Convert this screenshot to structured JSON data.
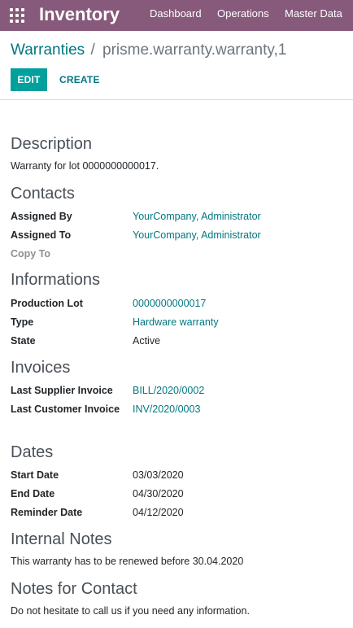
{
  "navbar": {
    "app_title": "Inventory",
    "menu": [
      "Dashboard",
      "Operations",
      "Master Data"
    ],
    "background": "#875a7b"
  },
  "breadcrumb": {
    "parent": "Warranties",
    "separator": "/",
    "current": "prisme.warranty.warranty,1"
  },
  "buttons": {
    "edit": "EDIT",
    "create": "CREATE"
  },
  "form": {
    "description": {
      "title": "Description",
      "text": "Warranty for lot 0000000000017."
    },
    "contacts": {
      "title": "Contacts",
      "fields": [
        {
          "label": "Assigned By",
          "value": "YourCompany, Administrator"
        },
        {
          "label": "Assigned To",
          "value": "YourCompany, Administrator"
        },
        {
          "label": "Copy To",
          "value": ""
        }
      ]
    },
    "informations": {
      "title": "Informations",
      "fields": [
        {
          "label": "Production Lot",
          "value": "0000000000017"
        },
        {
          "label": "Type",
          "value": "Hardware warranty"
        },
        {
          "label": "State",
          "value": "Active"
        }
      ]
    },
    "invoices": {
      "title": "Invoices",
      "fields": [
        {
          "label": "Last Supplier Invoice",
          "value": "BILL/2020/0002"
        },
        {
          "label": "Last Customer Invoice",
          "value": "INV/2020/0003"
        }
      ]
    },
    "dates": {
      "title": "Dates",
      "fields": [
        {
          "label": "Start Date",
          "value": "03/03/2020"
        },
        {
          "label": "End Date",
          "value": "04/30/2020"
        },
        {
          "label": "Reminder Date",
          "value": "04/12/2020"
        }
      ]
    },
    "internal_notes": {
      "title": "Internal Notes",
      "text": "This warranty has to be renewed before 30.04.2020"
    },
    "notes_for_contact": {
      "title": "Notes for Contact",
      "text": "Do not hesitate to call us if you need any information."
    }
  },
  "colors": {
    "primary": "#00a09d",
    "link": "#00777f",
    "muted": "#8f8f8f"
  }
}
